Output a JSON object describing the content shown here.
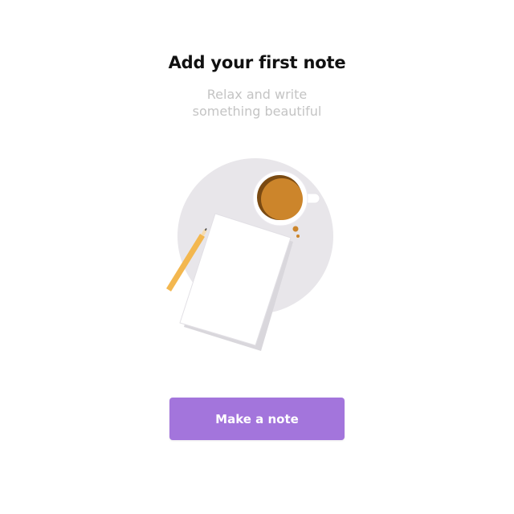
{
  "empty_state": {
    "title": "Add your first note",
    "subtitle_line1": "Relax and write",
    "subtitle_line2": "something beautiful",
    "illustration_icon": "note-with-coffee-illustration"
  },
  "actions": {
    "make_note_label": "Make a note"
  },
  "colors": {
    "accent": "#a375dc",
    "title": "#111111",
    "subtitle": "#c4c4c4",
    "plate": "#e8e6ea",
    "coffee": "#cc852b",
    "pencil": "#f3b74f"
  }
}
